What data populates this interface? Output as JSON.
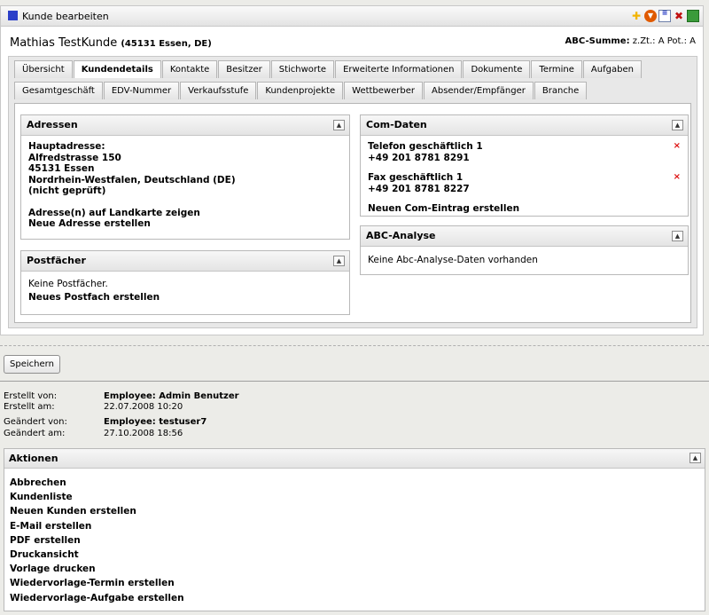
{
  "window": {
    "title": "Kunde bearbeiten"
  },
  "toolbar_icons": [
    "add-icon",
    "dropdown-icon",
    "list-icon",
    "close-icon",
    "save-icon"
  ],
  "customer": {
    "name": "Mathias TestKunde",
    "location": "(45131 Essen, DE)"
  },
  "abc_summary": {
    "label": "ABC-Summe:",
    "text": "z.Zt.: A Pot.: A"
  },
  "tabs_row1": [
    "Übersicht",
    "Kundendetails",
    "Kontakte",
    "Besitzer",
    "Stichworte",
    "Erweiterte Informationen",
    "Dokumente",
    "Termine",
    "Aufgaben"
  ],
  "tabs_row2": [
    "Gesamtgeschäft",
    "EDV-Nummer",
    "Verkaufsstufe",
    "Kundenprojekte",
    "Wettbewerber",
    "Absender/Empfänger",
    "Branche"
  ],
  "active_tab": "Kundendetails",
  "adressen": {
    "title": "Adressen",
    "label": "Hauptadresse:",
    "street": "Alfredstrasse 150",
    "city": "45131 Essen",
    "region": "Nordrhein-Westfalen, Deutschland (DE)",
    "status": "(nicht geprüft)",
    "map_link": "Adresse(n) auf Landkarte zeigen",
    "new_link": "Neue Adresse erstellen"
  },
  "postfaecher": {
    "title": "Postfächer",
    "empty": "Keine Postfächer.",
    "new_link": "Neues Postfach erstellen"
  },
  "com_daten": {
    "title": "Com-Daten",
    "entries": [
      {
        "label": "Telefon geschäftlich 1",
        "value": "+49 201 8781 8291",
        "delete": "×"
      },
      {
        "label": "Fax geschäftlich 1",
        "value": "+49 201 8781 8227",
        "delete": "×"
      }
    ],
    "new_link": "Neuen Com-Eintrag erstellen"
  },
  "abc_analyse": {
    "title": "ABC-Analyse",
    "empty": "Keine Abc-Analyse-Daten vorhanden"
  },
  "save_button": "Speichern",
  "meta": {
    "created_by_label": "Erstellt von:",
    "created_by": "Employee: Admin Benutzer",
    "created_at_label": "Erstellt am:",
    "created_at": "22.07.2008 10:20",
    "changed_by_label": "Geändert von:",
    "changed_by": "Employee: testuser7",
    "changed_at_label": "Geändert am:",
    "changed_at": "27.10.2008 18:56"
  },
  "aktionen": {
    "title": "Aktionen",
    "items": [
      "Abbrechen",
      "Kundenliste",
      "Neuen Kunden erstellen",
      "E-Mail erstellen",
      "PDF erstellen",
      "Druckansicht",
      "Vorlage drucken",
      "Wiedervorlage-Termin erstellen",
      "Wiedervorlage-Aufgabe erstellen"
    ]
  },
  "colors": {
    "title_square": "#2b3fc8",
    "delete_x": "#dd1111",
    "add_icon": "#f2b400",
    "dropdown_icon": "#e05a00",
    "save_icon": "#3a9b3a"
  }
}
